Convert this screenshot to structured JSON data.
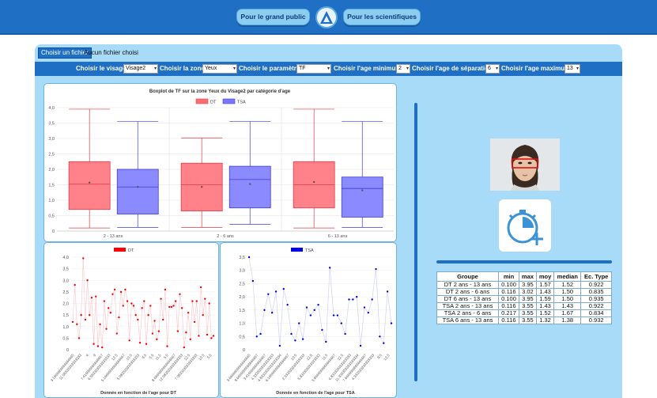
{
  "nav": {
    "public_label": "Pour le grand public",
    "scientists_label": "Pour les scientifiques"
  },
  "file": {
    "button_label": "Choisir un fichier",
    "status": "Aucun fichier choisi"
  },
  "params": {
    "visage_label": "Choisir le visage:",
    "visage_value": "Visage2",
    "zone_label": "Choisir la zone:",
    "zone_value": "Yeux",
    "parametre_label": "Choisir le paramètre:",
    "parametre_value": "TF",
    "age_min_label": "Choisir l'age minimum:",
    "age_min_value": "2",
    "age_sep_label": "Choisir l'age de séparation:",
    "age_sep_value": "6",
    "age_max_label": "Choisir l'age maximum:",
    "age_max_value": "13"
  },
  "colors": {
    "dt": "#ff6b75",
    "tsa": "#7777ff",
    "dt_line": "#ff0000",
    "tsa_line": "#0000ee",
    "accent": "#1f6fc4"
  },
  "stats_table": {
    "headers": [
      "Groupe",
      "min",
      "max",
      "moy",
      "median",
      "Ec. Type"
    ],
    "rows": [
      [
        "DT 2 ans - 13 ans",
        "0.100",
        "3.95",
        "1.57",
        "1.52",
        "0.922"
      ],
      [
        "DT 2 ans - 6 ans",
        "0.116",
        "3.02",
        "1.43",
        "1.50",
        "0.835"
      ],
      [
        "DT 6 ans - 13 ans",
        "0.100",
        "3.95",
        "1.59",
        "1.50",
        "0.935"
      ],
      [
        "TSA 2 ans - 13 ans",
        "0.116",
        "3.55",
        "1.43",
        "1.43",
        "0.922"
      ],
      [
        "TSA 2 ans - 6 ans",
        "0.217",
        "3.55",
        "1.52",
        "1.67",
        "0.834"
      ],
      [
        "TSA 6 ans - 13 ans",
        "0.116",
        "3.55",
        "1.32",
        "1.38",
        "0.932"
      ]
    ]
  },
  "chart_data": [
    {
      "type": "boxplot",
      "title": "Boxplot de TF sur la zone Yeux du Visage2 par catégorie d'age",
      "legend": [
        "DT",
        "TSA"
      ],
      "legend_position": "top",
      "categories": [
        "2 - 13 ans",
        "2 - 6 ans",
        "6 - 13 ans"
      ],
      "yticks": [
        "0",
        "0,5",
        "1,0",
        "1,5",
        "2,0",
        "2,5",
        "3,0",
        "3,5",
        "4,0"
      ],
      "ylim": [
        0,
        4
      ],
      "grid": true,
      "series": [
        {
          "name": "DT",
          "boxes": [
            {
              "min": 0.1,
              "q1": 0.7,
              "median": 1.52,
              "q3": 2.25,
              "max": 3.95,
              "mean": 1.57
            },
            {
              "min": 0.116,
              "q1": 0.65,
              "median": 1.5,
              "q3": 2.2,
              "max": 3.02,
              "mean": 1.43
            },
            {
              "min": 0.1,
              "q1": 0.75,
              "median": 1.5,
              "q3": 2.25,
              "max": 3.95,
              "mean": 1.59
            }
          ]
        },
        {
          "name": "TSA",
          "boxes": [
            {
              "min": 0.116,
              "q1": 0.55,
              "median": 1.43,
              "q3": 2.0,
              "max": 3.55,
              "mean": 1.43
            },
            {
              "min": 0.217,
              "q1": 0.75,
              "median": 1.67,
              "q3": 2.1,
              "max": 3.55,
              "mean": 1.52
            },
            {
              "min": 0.116,
              "q1": 0.45,
              "median": 1.38,
              "q3": 1.75,
              "max": 3.55,
              "mean": 1.32
            }
          ]
        }
      ]
    },
    {
      "type": "line",
      "legend": [
        "DT"
      ],
      "legend_position": "top",
      "xlabel": "Donnée en fonction de l'age pour DT",
      "yticks": [
        "0",
        "0,5",
        "1,0",
        "1,5",
        "2,0",
        "2,5",
        "3,0",
        "3,5",
        "4,0"
      ],
      "ylim": [
        0,
        4
      ],
      "xtick_labels": [
        "3.1666666666666665",
        "11.08333333333333",
        "6",
        "9",
        "7.416666666666667",
        "6.583333333333333",
        "12.5",
        "5.1666666666666667",
        "10.5",
        "5.083333333333333",
        "8.5",
        "5.5",
        "11.5",
        "5.5",
        "8.6666666666666667",
        "12.083333333333333",
        "12.5",
        "7.083333333333333",
        "10.5",
        "5.5"
      ],
      "values": [
        1.2,
        2.8,
        1.1,
        0.5,
        1.5,
        3.95,
        1.3,
        3.0,
        1.5,
        2.25,
        0.25,
        2.3,
        0.15,
        1.1,
        0.1,
        2.1,
        0.9,
        1.8,
        1.6,
        2.4,
        2.6,
        0.7,
        1.4,
        2.5,
        1.9,
        2.6,
        2.1,
        0.4,
        2.0,
        1.9,
        1.5,
        1.3,
        0.3,
        1.8,
        2.1,
        0.25,
        1.5,
        1.9,
        0.7,
        1.25,
        0.45,
        0.8,
        2.2,
        1.3,
        2.6,
        0.15,
        1.85,
        1.85,
        1.9,
        2.1,
        0.8,
        2.4,
        1.8,
        0.1,
        0.75,
        1.6,
        0.45,
        2.1,
        1.2,
        2.1,
        0.6,
        2.7,
        1.5,
        2.2,
        0.65,
        2.0,
        0.5,
        0.6
      ]
    },
    {
      "type": "line",
      "legend": [
        "TSA"
      ],
      "legend_position": "top",
      "xlabel": "Donnée en fonction de l'age pour TSA",
      "yticks": [
        "0",
        "0,5",
        "1,0",
        "1,5",
        "2,0",
        "2,5",
        "3,0",
        "3,5"
      ],
      "ylim": [
        0,
        3.5
      ],
      "xtick_labels": [
        "3.6666666666666665",
        "8.6666666666666667",
        "3.416666666666667",
        "4.333333333333333",
        "4.8333333333333334",
        "6.1666666666666667",
        "10.5",
        "2.333333333333333",
        "12.5",
        "5.833333333333333",
        "11.5",
        "5.6666666666666667",
        "12.5",
        "6.833333333333333",
        "11.333333333333334",
        "7.6666666666666667",
        "4.333333333333333",
        "9.5",
        "12.5"
      ],
      "values": [
        3.5,
        2.6,
        0.5,
        0.6,
        1.5,
        2.1,
        1.4,
        2.2,
        0.15,
        2.3,
        1.7,
        0.6,
        0.35,
        1.0,
        0.4,
        1.6,
        1.3,
        1.5,
        1.7,
        0.75,
        0.3,
        3.1,
        1.3,
        1.3,
        1.0,
        0.6,
        1.9,
        1.9,
        2.0,
        0.15,
        1.6,
        1.4,
        1.9,
        3.05,
        0.5,
        0.25,
        2.2,
        1.0
      ]
    }
  ]
}
